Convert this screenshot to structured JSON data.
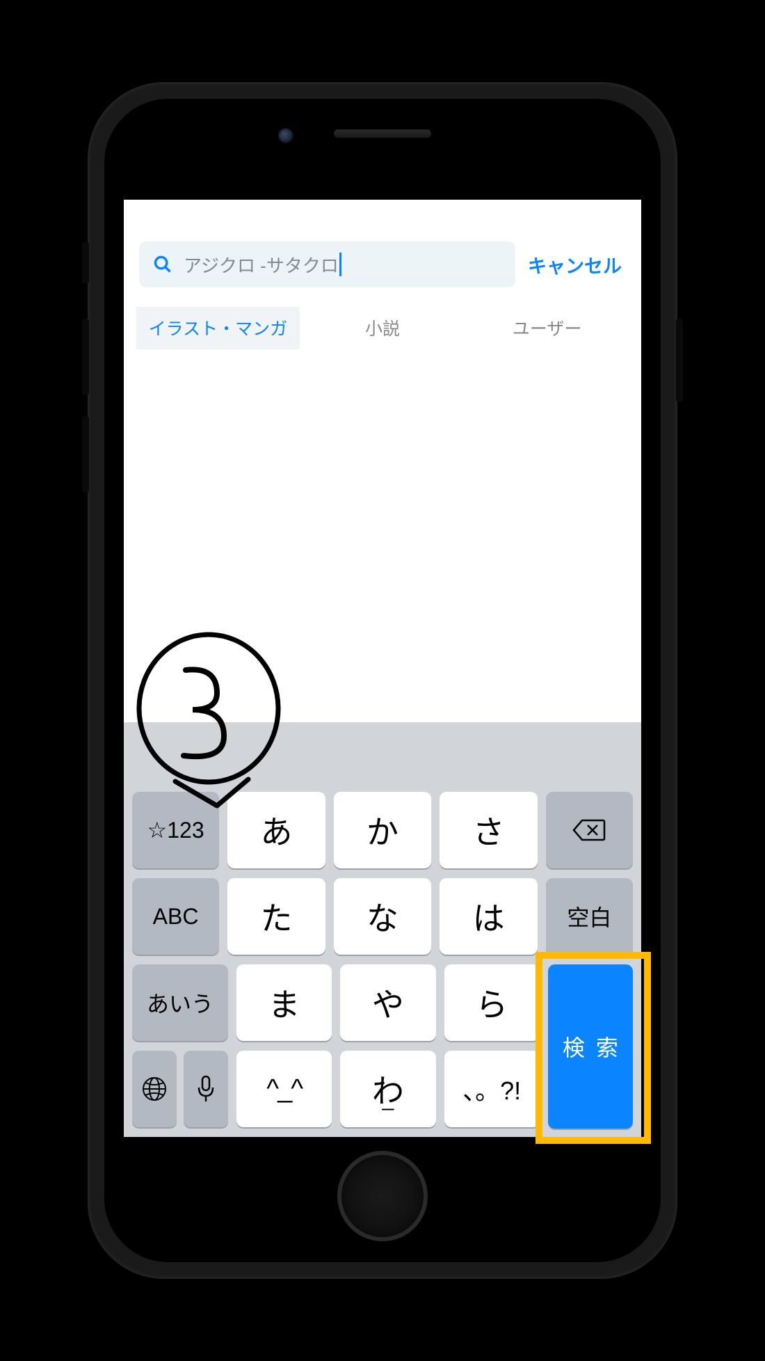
{
  "search": {
    "value": "アジクロ -サタクロ",
    "cancel": "キャンセル"
  },
  "tabs": {
    "illust": "イラスト・マンガ",
    "novel": "小説",
    "user": "ユーザー"
  },
  "annotation": {
    "number": "3"
  },
  "keyboard": {
    "num": "☆123",
    "abc": "ABC",
    "aiu": "あいう",
    "space": "空白",
    "search": "検索",
    "a": "あ",
    "ka": "か",
    "sa": "さ",
    "ta": "た",
    "na": "な",
    "ha": "は",
    "ma": "ま",
    "ya": "や",
    "ra": "ら",
    "caret": "^_^",
    "wa": "わ",
    "wa_sub": "ー",
    "punct": "、。?!"
  },
  "colors": {
    "accent": "#0a84ff",
    "highlight": "#ffba00"
  }
}
